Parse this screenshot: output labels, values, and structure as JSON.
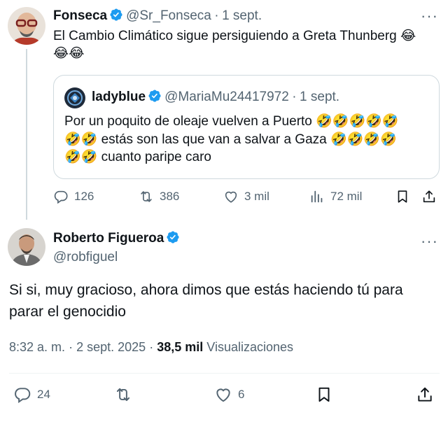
{
  "tweet1": {
    "name": "Fonseca",
    "handle": "@Sr_Fonseca",
    "sep": "·",
    "date": "1 sept.",
    "text_line1": "El Cambio Climático sigue persiguiendo a Greta Thunberg 😂",
    "text_line2": "😂😂",
    "quote": {
      "name": "ladyblue",
      "handle": "@MariaMu24417972",
      "sep": "·",
      "date": "1 sept.",
      "line1": "Por un poquito de oleaje vuelven a Puerto 🤣🤣🤣🤣🤣",
      "line2": "🤣🤣 estás son las que van a salvar a Gaza 🤣🤣🤣🤣",
      "line3": "🤣🤣 cuanto paripe caro"
    },
    "actions": {
      "replies": "126",
      "reposts": "386",
      "likes": "3 mil",
      "views": "72 mil"
    }
  },
  "tweet2": {
    "name": "Roberto Figueroa",
    "handle": "@robfiguel",
    "text": "Si si, muy gracioso, ahora dimos que estás haciendo tú para parar el genocidio",
    "time": "8:32 a. m.",
    "sep": "·",
    "date": "2 sept. 2025",
    "sep2": "·",
    "views_count": "38,5 mil",
    "views_label": "Visualizaciones",
    "actions": {
      "replies": "24",
      "likes": "6"
    }
  },
  "colors": {
    "verified": "#1d9bf0",
    "secondary_text": "#536471",
    "border": "#cfd9de"
  }
}
